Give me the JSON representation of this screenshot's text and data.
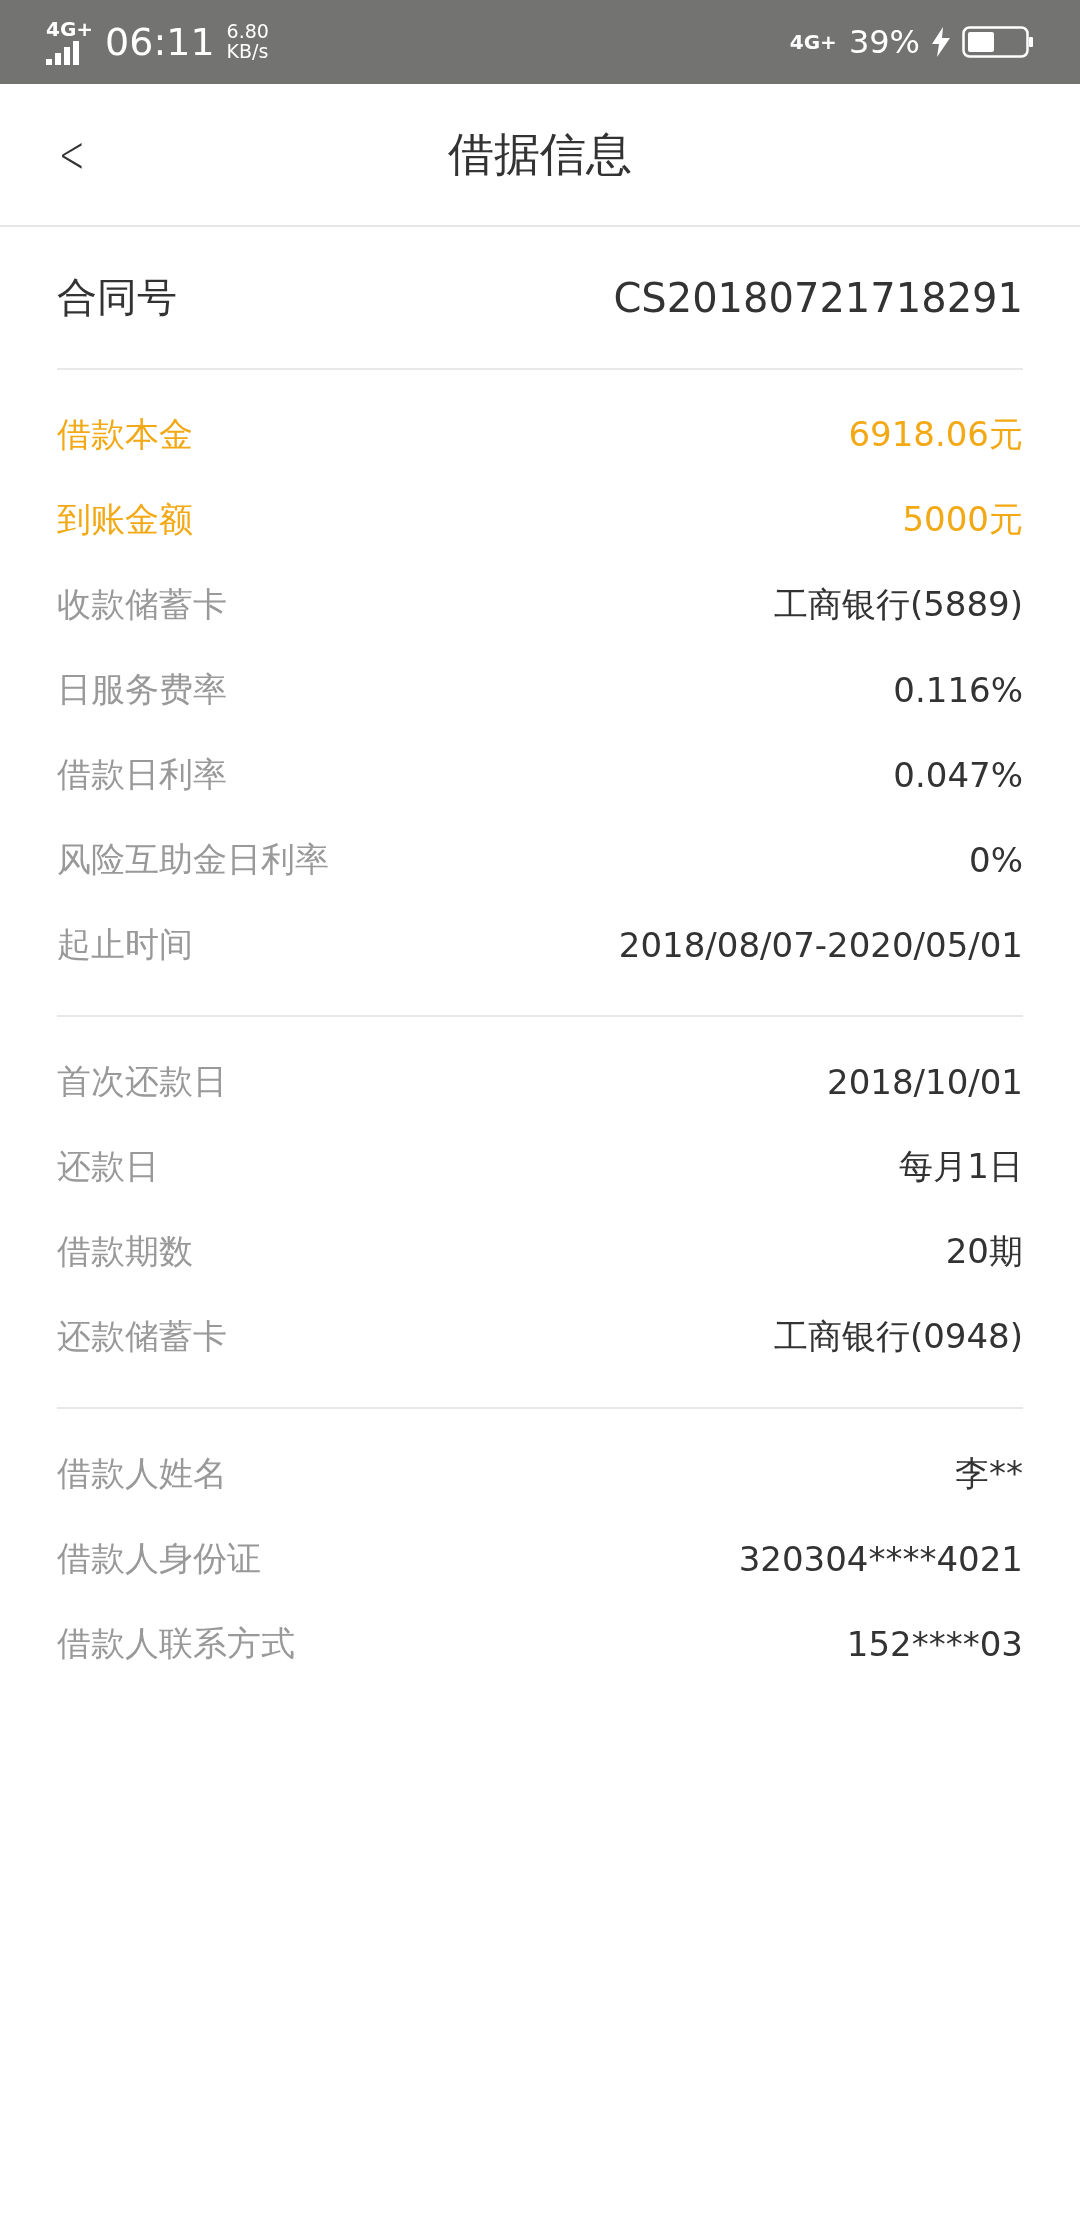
{
  "status_bar": {
    "network_left": "4G+",
    "time": "06:11",
    "speed": "6.80",
    "speed_unit": "KB/s",
    "network_right": "4G+",
    "battery": "39%"
  },
  "header": {
    "back": "<",
    "title": "借据信息"
  },
  "contract": {
    "label": "合同号",
    "value": "CS20180721718291"
  },
  "sections": [
    {
      "rows": [
        {
          "label": "借款本金",
          "value": "6918.06元",
          "highlight": true
        },
        {
          "label": "到账金额",
          "value": "5000元",
          "highlight": true
        },
        {
          "label": "收款储蓄卡",
          "value": "工商银行(5889)",
          "highlight": false
        },
        {
          "label": "日服务费率",
          "value": "0.116%",
          "highlight": false
        },
        {
          "label": "借款日利率",
          "value": "0.047%",
          "highlight": false
        },
        {
          "label": "风险互助金日利率",
          "value": "0%",
          "highlight": false
        },
        {
          "label": "起止时间",
          "value": "2018/08/07-2020/05/01",
          "highlight": false
        }
      ]
    },
    {
      "rows": [
        {
          "label": "首次还款日",
          "value": "2018/10/01",
          "highlight": false
        },
        {
          "label": "还款日",
          "value": "每月1日",
          "highlight": false
        },
        {
          "label": "借款期数",
          "value": "20期",
          "highlight": false
        },
        {
          "label": "还款储蓄卡",
          "value": "工商银行(0948)",
          "highlight": false
        }
      ]
    },
    {
      "rows": [
        {
          "label": "借款人姓名",
          "value": "李**",
          "highlight": false
        },
        {
          "label": "借款人身份证",
          "value": "320304****4021",
          "highlight": false
        },
        {
          "label": "借款人联系方式",
          "value": "152****03",
          "highlight": false
        }
      ]
    }
  ]
}
